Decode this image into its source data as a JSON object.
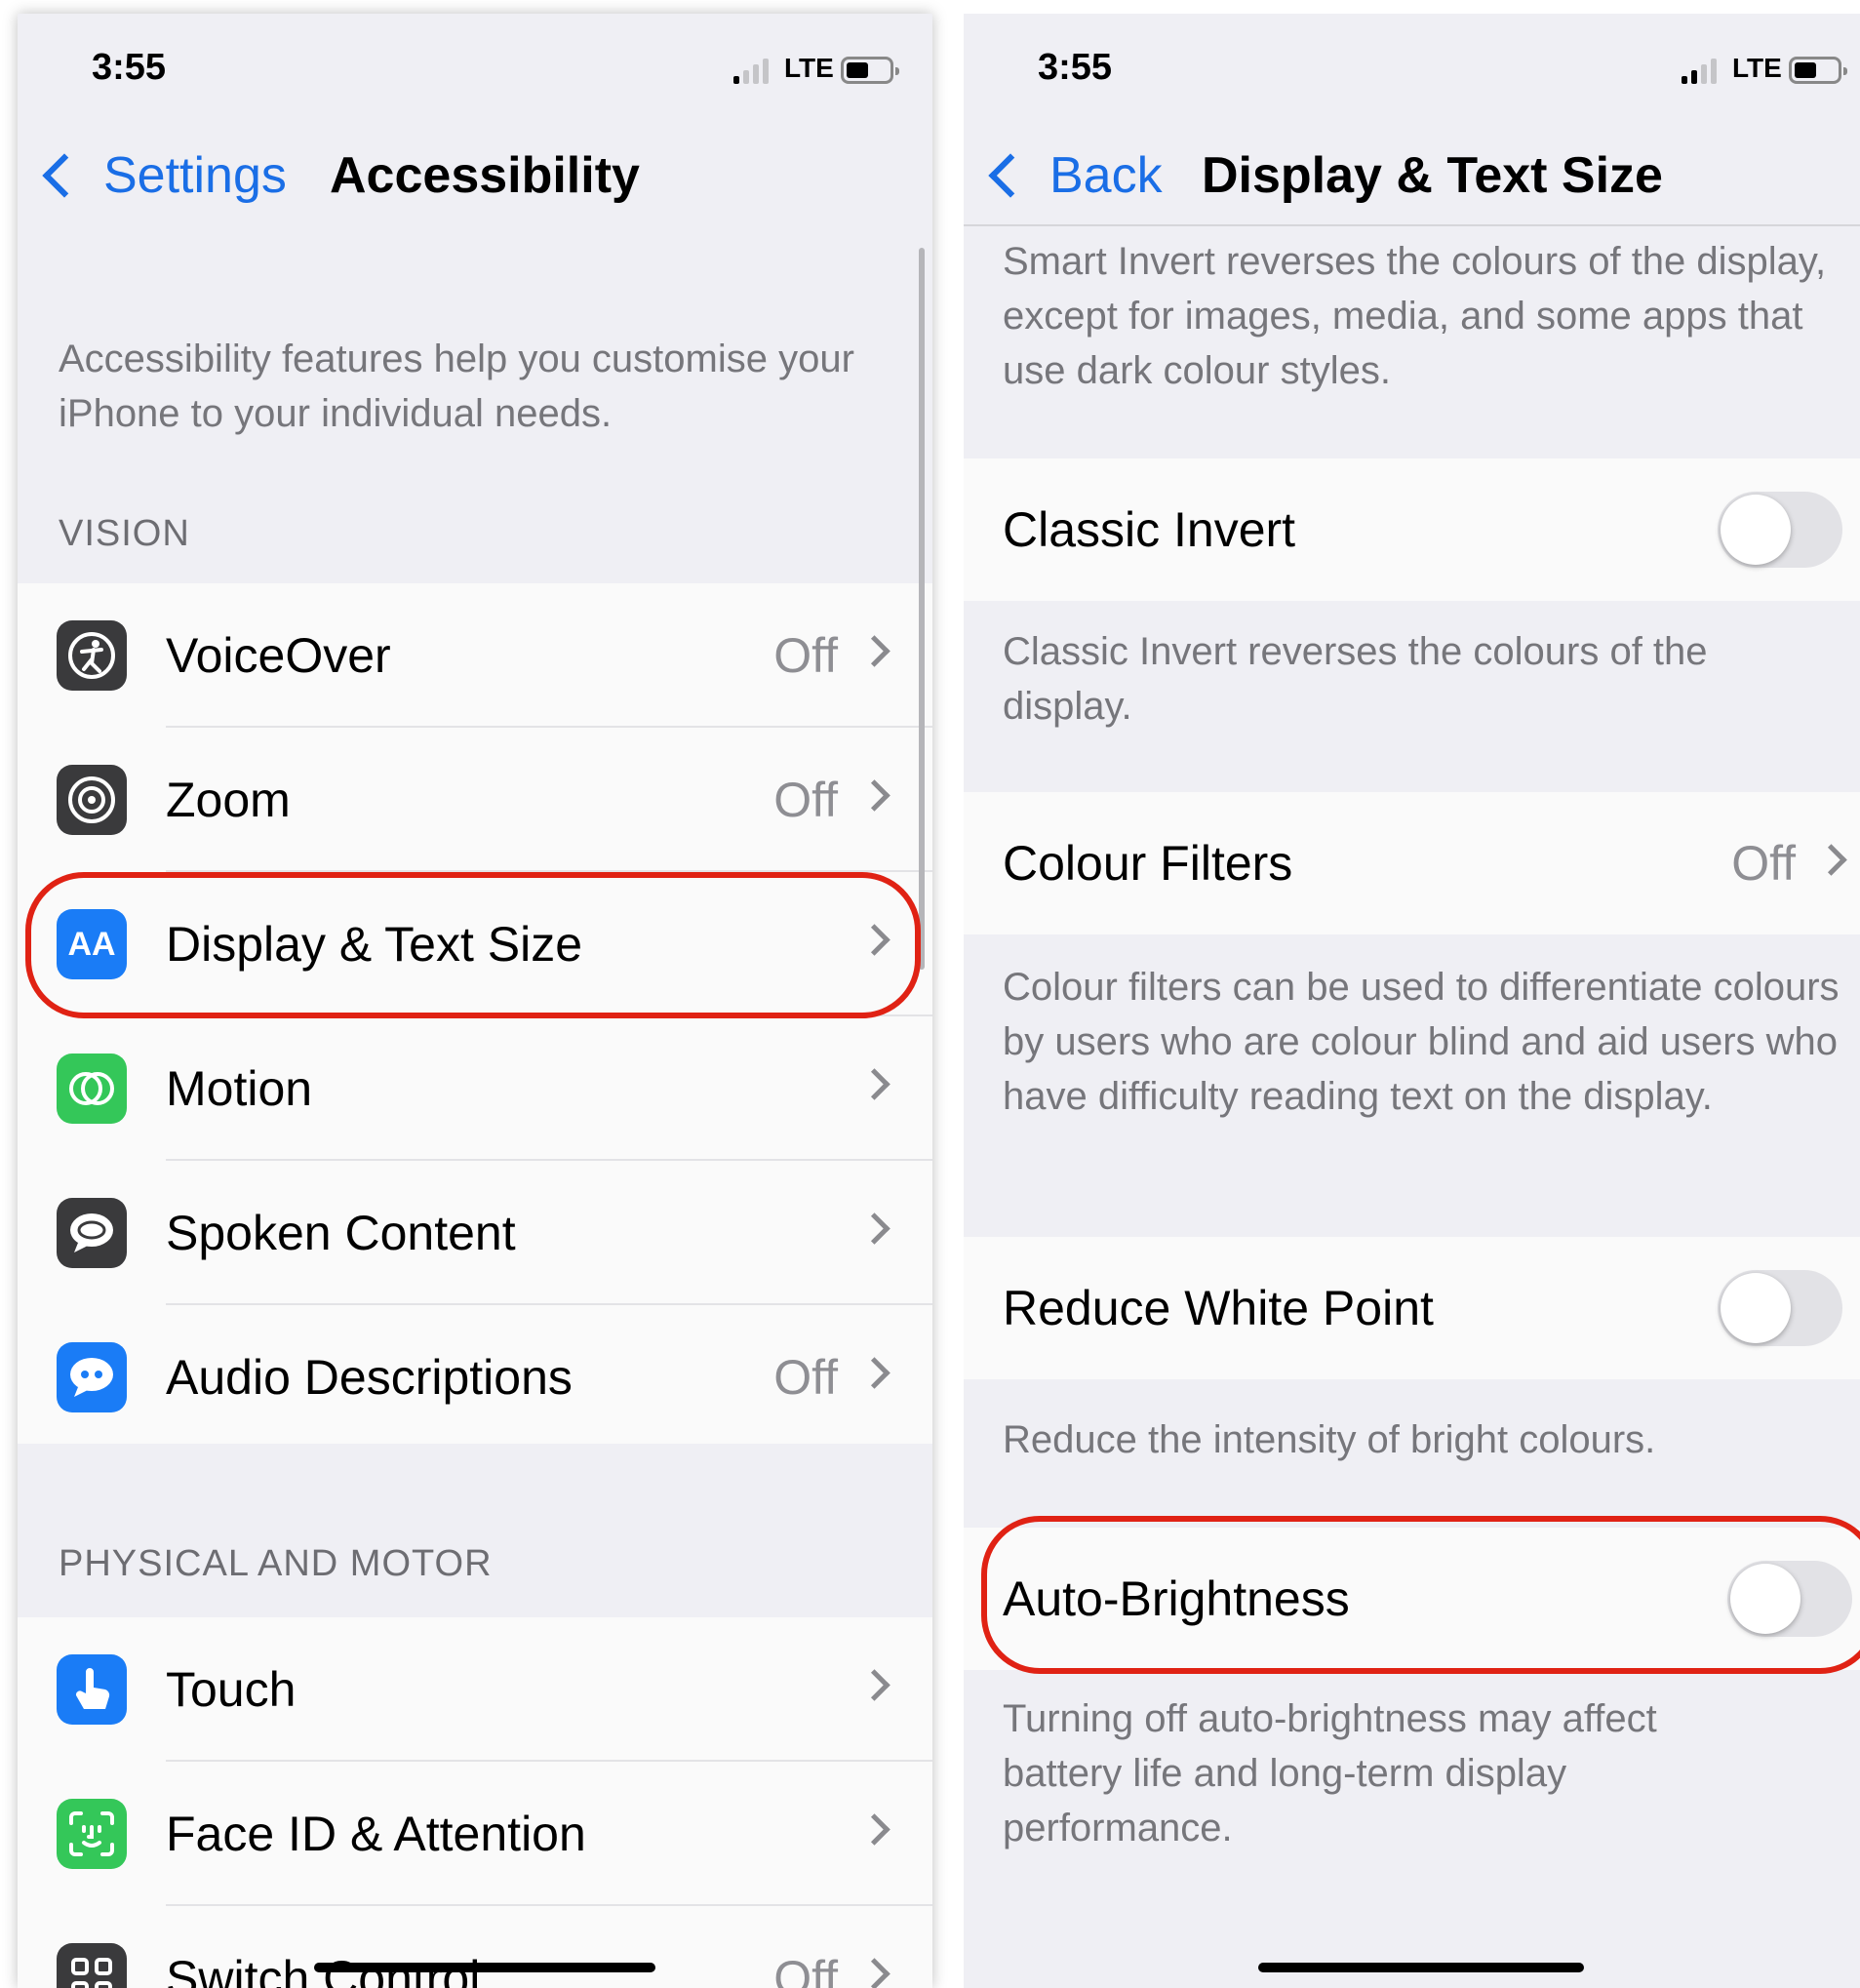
{
  "left": {
    "status": {
      "time": "3:55",
      "network": "LTE"
    },
    "nav": {
      "back_label": "Settings",
      "title": "Accessibility"
    },
    "intro": "Accessibility features help you customise your iPhone to your individual needs.",
    "sections": {
      "vision": "VISION",
      "physical": "PHYSICAL AND MOTOR"
    },
    "vision_rows": [
      {
        "label": "VoiceOver",
        "value": "Off",
        "icon": "voiceover-icon",
        "color": "#3a3a3c"
      },
      {
        "label": "Zoom",
        "value": "Off",
        "icon": "zoom-icon",
        "color": "#3a3a3c"
      },
      {
        "label": "Display & Text Size",
        "value": "",
        "icon": "text-size-icon",
        "color": "#1a7cf6"
      },
      {
        "label": "Motion",
        "value": "",
        "icon": "motion-icon",
        "color": "#34c759"
      },
      {
        "label": "Spoken Content",
        "value": "",
        "icon": "speech-bubble-icon",
        "color": "#3a3a3c"
      },
      {
        "label": "Audio Descriptions",
        "value": "Off",
        "icon": "audio-description-icon",
        "color": "#1a7cf6"
      }
    ],
    "motor_rows": [
      {
        "label": "Touch",
        "value": "",
        "icon": "touch-hand-icon",
        "color": "#1a7cf6"
      },
      {
        "label": "Face ID & Attention",
        "value": "",
        "icon": "face-id-icon",
        "color": "#34c759"
      },
      {
        "label": "Switch Control",
        "value": "Off",
        "icon": "switch-control-icon",
        "color": "#3a3a3c"
      }
    ],
    "icon_glyphs": {
      "text_size": "AA"
    }
  },
  "right": {
    "status": {
      "time": "3:55",
      "network": "LTE"
    },
    "nav": {
      "back_label": "Back",
      "title": "Display & Text Size"
    },
    "smart_invert_desc": "Smart Invert reverses the colours of the display, except for images, media, and some apps that use dark colour styles.",
    "classic_invert": {
      "label": "Classic Invert",
      "on": false,
      "desc": "Classic Invert reverses the colours of the display."
    },
    "colour_filters": {
      "label": "Colour Filters",
      "value": "Off",
      "desc": "Colour filters can be used to differentiate colours by users who are colour blind and aid users who have difficulty reading text on the display."
    },
    "reduce_white_point": {
      "label": "Reduce White Point",
      "on": false,
      "desc": "Reduce the intensity of bright colours."
    },
    "auto_brightness": {
      "label": "Auto-Brightness",
      "on": false,
      "desc": "Turning off auto-brightness may affect battery life and long-term display performance."
    }
  },
  "highlight_color": "#e02214"
}
